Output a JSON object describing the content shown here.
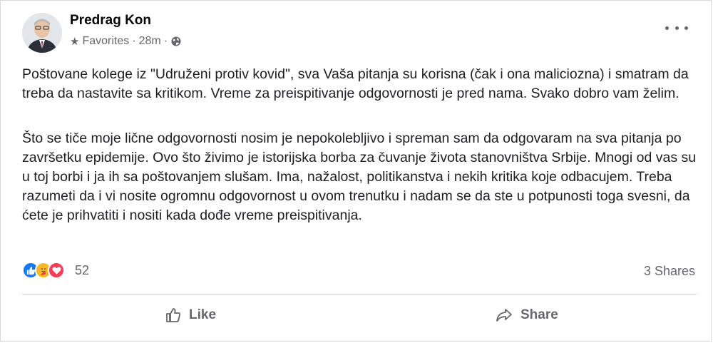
{
  "post": {
    "author": "Predrag Kon",
    "audience": "Favorites",
    "separator": "·",
    "time": "28m",
    "paragraphs": [
      "Poštovane kolege iz \"Udruženi protiv kovid\", sva Vaša pitanja su korisna (čak i ona maliciozna) i smatram da treba da nastavite sa kritikom. Vreme za preispitivanje odgovornosti je pred nama. Svako dobro vam želim.",
      "Što se tiče moje lične odgovornosti nosim je nepokolebljivo i spreman sam da odgovaram na sva pitanja po završetku epidemije. Ovo što živimo je istorijska borba za čuvanje života stanovništva Srbije. Mnogi od vas su u toj borbi i ja ih sa poštovanjem slušam. Ima, nažalost, politikanstva i nekih kritika koje odbacujem. Treba razumeti da i vi nosite ogromnu odgovornost u ovom trenutku i nadam se da ste u potpunosti toga svesni, da ćete je prihvatiti i nositi kada dođe vreme preispitivanja."
    ],
    "reaction_count": "52",
    "shares": "3 Shares"
  },
  "actions": {
    "like": "Like",
    "share": "Share"
  },
  "icons": {
    "reactions": [
      "like-icon",
      "care-icon",
      "love-icon"
    ],
    "audience": "star-icon",
    "visibility": "globe-icon",
    "menu": "more-options-icon"
  },
  "colors": {
    "like": "#1877f2",
    "care": "#f7b928",
    "love": "#f33e58",
    "secondary_text": "#65676b"
  }
}
